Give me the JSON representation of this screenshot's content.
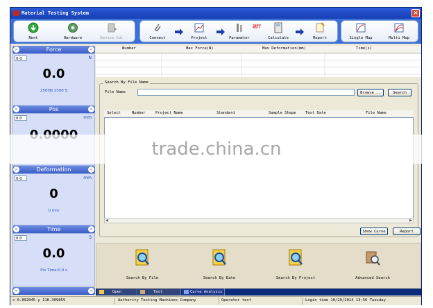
{
  "window": {
    "title": "Material Testing System"
  },
  "toolbar": {
    "buttons": [
      {
        "label": "Next",
        "icon": "green-arrow-icon"
      },
      {
        "label": "Hardware",
        "icon": "gear-icon"
      },
      {
        "label": "Device Cal",
        "icon": "document-plus-icon"
      },
      {
        "label": "Connect",
        "icon": "paperclip-icon"
      },
      {
        "label": "Project",
        "icon": "project-chart-icon"
      },
      {
        "label": "Parameter",
        "icon": "parameter-icon"
      },
      {
        "label": "Calculate",
        "icon": "calculator-icon"
      },
      {
        "label": "Report",
        "icon": "report-icon"
      },
      {
        "label": "Single Map",
        "icon": "single-curve-icon"
      },
      {
        "label": "Multi Map",
        "icon": "multi-curve-icon"
      }
    ],
    "badge": "运行"
  },
  "panels": {
    "force": {
      "title": "Force",
      "small_value": "0.0",
      "unit": "N",
      "value": "0.0",
      "sub": "2500N 2500 S"
    },
    "pos": {
      "title": "Pos",
      "small_value": "0.0",
      "unit": "mm",
      "value": "0.0000"
    },
    "deformation": {
      "title": "Deformation",
      "small_value": "0.0",
      "unit": "mm",
      "value": "0",
      "sub": "0 mm"
    },
    "time": {
      "title": "Time",
      "small_value": "0.0",
      "unit": "S",
      "value": "0.0",
      "sub": "Pin Time:0.0 s"
    }
  },
  "top_table": {
    "columns": [
      "Number",
      "Max Force(N)",
      "Max Deformation(mm)",
      "Time(s)"
    ]
  },
  "search": {
    "legend": "Search By File Name",
    "file_label": "File Name",
    "browse": "Browse ..",
    "search": "Search",
    "columns": [
      "Select",
      "Number",
      "Project Name",
      "Standard",
      "Sample Shape",
      "Test Date",
      "File Name"
    ],
    "show_curve": "Show Curve",
    "report": "Report"
  },
  "bottom_buttons": [
    {
      "label": "Search By File",
      "icon": "search-file-icon"
    },
    {
      "label": "Search By Date",
      "icon": "search-date-icon"
    },
    {
      "label": "Search By Project",
      "icon": "search-project-icon"
    },
    {
      "label": "Advanced Search",
      "icon": "advanced-search-icon"
    }
  ],
  "tabs": [
    {
      "label": "Open",
      "icon": "folder-icon"
    },
    {
      "label": "Test",
      "icon": "test-icon"
    },
    {
      "label": "Curve Analysis",
      "icon": "curve-analysis-icon"
    }
  ],
  "status": {
    "coords": "x 0.892045 y 118.309859",
    "company": "Authority Testing Machines Company",
    "operator": "Operator test",
    "login": "Login time 10/29/2014 13:56 Tuesday"
  },
  "watermark": "trade.china.cn"
}
